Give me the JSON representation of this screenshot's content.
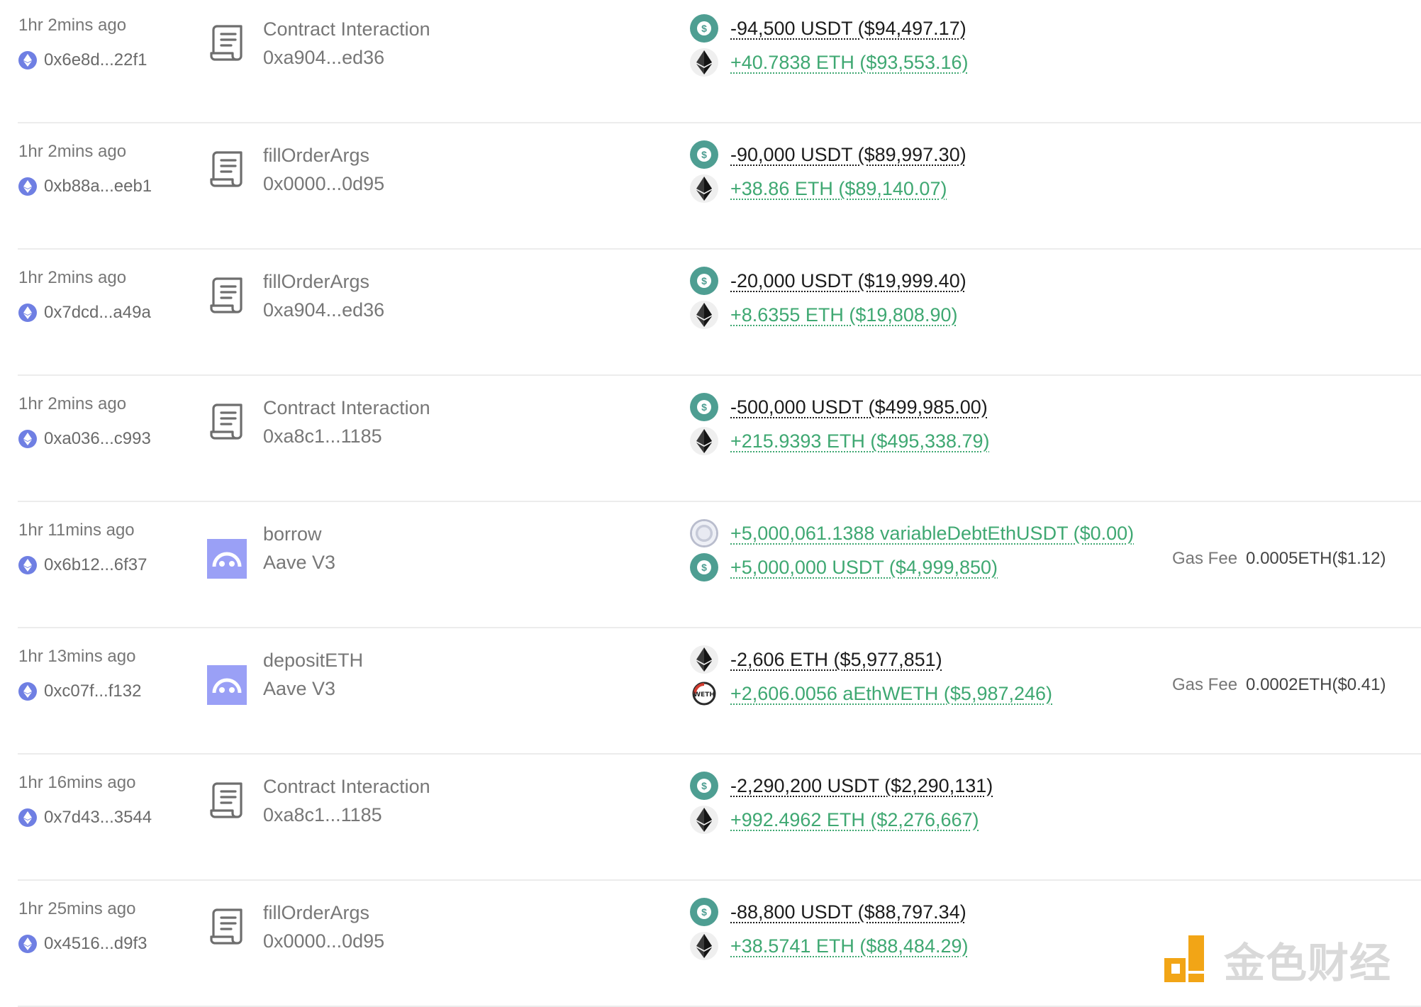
{
  "transactions": [
    {
      "time": "1hr 2mins ago",
      "hash": "0x6e8d...22f1",
      "icon": "contract-icon",
      "method": "Contract Interaction",
      "target": "0xa904...ed36",
      "transfers": [
        {
          "token": "usdt",
          "direction": "out",
          "text": "-94,500 USDT ($94,497.17)"
        },
        {
          "token": "eth",
          "direction": "in",
          "text": "+40.7838 ETH ($93,553.16)"
        }
      ]
    },
    {
      "time": "1hr 2mins ago",
      "hash": "0xb88a...eeb1",
      "icon": "contract-icon",
      "method": "fillOrderArgs",
      "target": "0x0000...0d95",
      "transfers": [
        {
          "token": "usdt",
          "direction": "out",
          "text": "-90,000 USDT ($89,997.30)"
        },
        {
          "token": "eth",
          "direction": "in",
          "text": "+38.86 ETH ($89,140.07)"
        }
      ]
    },
    {
      "time": "1hr 2mins ago",
      "hash": "0x7dcd...a49a",
      "icon": "contract-icon",
      "method": "fillOrderArgs",
      "target": "0xa904...ed36",
      "transfers": [
        {
          "token": "usdt",
          "direction": "out",
          "text": "-20,000 USDT ($19,999.40)"
        },
        {
          "token": "eth",
          "direction": "in",
          "text": "+8.6355 ETH ($19,808.90)"
        }
      ]
    },
    {
      "time": "1hr 2mins ago",
      "hash": "0xa036...c993",
      "icon": "contract-icon",
      "method": "Contract Interaction",
      "target": "0xa8c1...1185",
      "transfers": [
        {
          "token": "usdt",
          "direction": "out",
          "text": "-500,000 USDT ($499,985.00)"
        },
        {
          "token": "eth",
          "direction": "in",
          "text": "+215.9393 ETH ($495,338.79)"
        }
      ]
    },
    {
      "time": "1hr 11mins ago",
      "hash": "0x6b12...6f37",
      "icon": "aave-icon",
      "method": "borrow",
      "target": "Aave V3",
      "transfers": [
        {
          "token": "debt",
          "direction": "in",
          "text": "+5,000,061.1388 variableDebtEthUSDT ($0.00)"
        },
        {
          "token": "usdt",
          "direction": "in",
          "text": "+5,000,000 USDT ($4,999,850)"
        }
      ],
      "gas_label": "Gas Fee",
      "gas_value": "0.0005ETH($1.12)"
    },
    {
      "time": "1hr 13mins ago",
      "hash": "0xc07f...f132",
      "icon": "aave-icon",
      "method": "depositETH",
      "target": "Aave V3",
      "transfers": [
        {
          "token": "eth",
          "direction": "out",
          "text": "-2,606 ETH ($5,977,851)"
        },
        {
          "token": "aeth",
          "direction": "in",
          "text": "+2,606.0056 aEthWETH ($5,987,246)",
          "badge": "WETH"
        }
      ],
      "gas_label": "Gas Fee",
      "gas_value": "0.0002ETH($0.41)"
    },
    {
      "time": "1hr 16mins ago",
      "hash": "0x7d43...3544",
      "icon": "contract-icon",
      "method": "Contract Interaction",
      "target": "0xa8c1...1185",
      "transfers": [
        {
          "token": "usdt",
          "direction": "out",
          "text": "-2,290,200 USDT ($2,290,131)"
        },
        {
          "token": "eth",
          "direction": "in",
          "text": "+992.4962 ETH ($2,276,667)"
        }
      ]
    },
    {
      "time": "1hr 25mins ago",
      "hash": "0x4516...d9f3",
      "icon": "contract-icon",
      "method": "fillOrderArgs",
      "target": "0x0000...0d95",
      "transfers": [
        {
          "token": "usdt",
          "direction": "out",
          "text": "-88,800 USDT ($88,797.34)"
        },
        {
          "token": "eth",
          "direction": "in",
          "text": "+38.5741 ETH ($88,484.29)"
        }
      ]
    }
  ],
  "watermark": {
    "text": "金色财经"
  },
  "colors": {
    "positive": "#3fa872",
    "negative": "#1c1c1c",
    "usdt": "#4e9e92",
    "aave": "#9aa0f6",
    "chain": "#6f7fe3",
    "watermark_logo": "#f2a516"
  }
}
